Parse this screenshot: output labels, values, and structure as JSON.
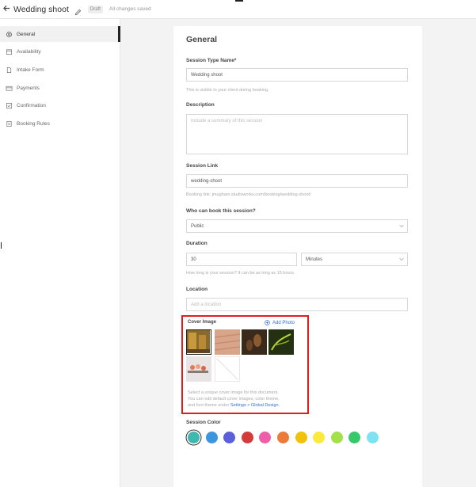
{
  "topbar": {
    "title": "Wedding shoot",
    "status_badge": "Draft",
    "save_status": "All changes saved"
  },
  "sidebar": {
    "items": [
      {
        "label": "General",
        "icon": "gear-icon"
      },
      {
        "label": "Availability",
        "icon": "calendar-icon"
      },
      {
        "label": "Intake Form",
        "icon": "document-icon"
      },
      {
        "label": "Payments",
        "icon": "card-icon"
      },
      {
        "label": "Confirmation",
        "icon": "check-square-icon"
      },
      {
        "label": "Booking Rules",
        "icon": "rules-icon"
      }
    ],
    "active_index": 0
  },
  "form": {
    "heading": "General",
    "session_type": {
      "label": "Session Type Name*",
      "value": "Wedding shoot",
      "hint": "This is visible to your client during booking."
    },
    "description": {
      "label": "Description",
      "placeholder": "Include a summary of this session"
    },
    "session_link": {
      "label": "Session Link",
      "value": "wedding-shoot",
      "hint": "Booking link: jmugham.studioworks.com/booking/wedding-shoot/"
    },
    "who_can_book": {
      "label": "Who can book this session?",
      "value": "Public"
    },
    "duration": {
      "label": "Duration",
      "value": "30",
      "unit": "Minutes",
      "hint": "How long is your session? It can be as long as 15 hours."
    },
    "location": {
      "label": "Location",
      "placeholder": "Add a location"
    },
    "cover_image": {
      "label": "Cover Image",
      "add_label": "Add Photo",
      "thumbnails": [
        {
          "name": "cover-thumb-1",
          "selected": true
        },
        {
          "name": "cover-thumb-2",
          "selected": false
        },
        {
          "name": "cover-thumb-3",
          "selected": false
        },
        {
          "name": "cover-thumb-4",
          "selected": false
        },
        {
          "name": "cover-thumb-5",
          "selected": false
        },
        {
          "name": "cover-thumb-none",
          "selected": false
        }
      ],
      "hint_line1": "Select a unique cover image for this document.",
      "hint_line2": "You can edit default cover images, color theme,",
      "hint_line3": "and font theme under",
      "hint_link": "Settings > Global Design."
    },
    "session_color": {
      "label": "Session Color",
      "colors": [
        "#3fb8af",
        "#3d95e0",
        "#5b5fdc",
        "#d63b3b",
        "#ee5fa7",
        "#ec7b3a",
        "#f2c10a",
        "#fbe93b",
        "#a3e04a",
        "#36c96a",
        "#7de3f2"
      ],
      "selected_index": 0
    }
  }
}
